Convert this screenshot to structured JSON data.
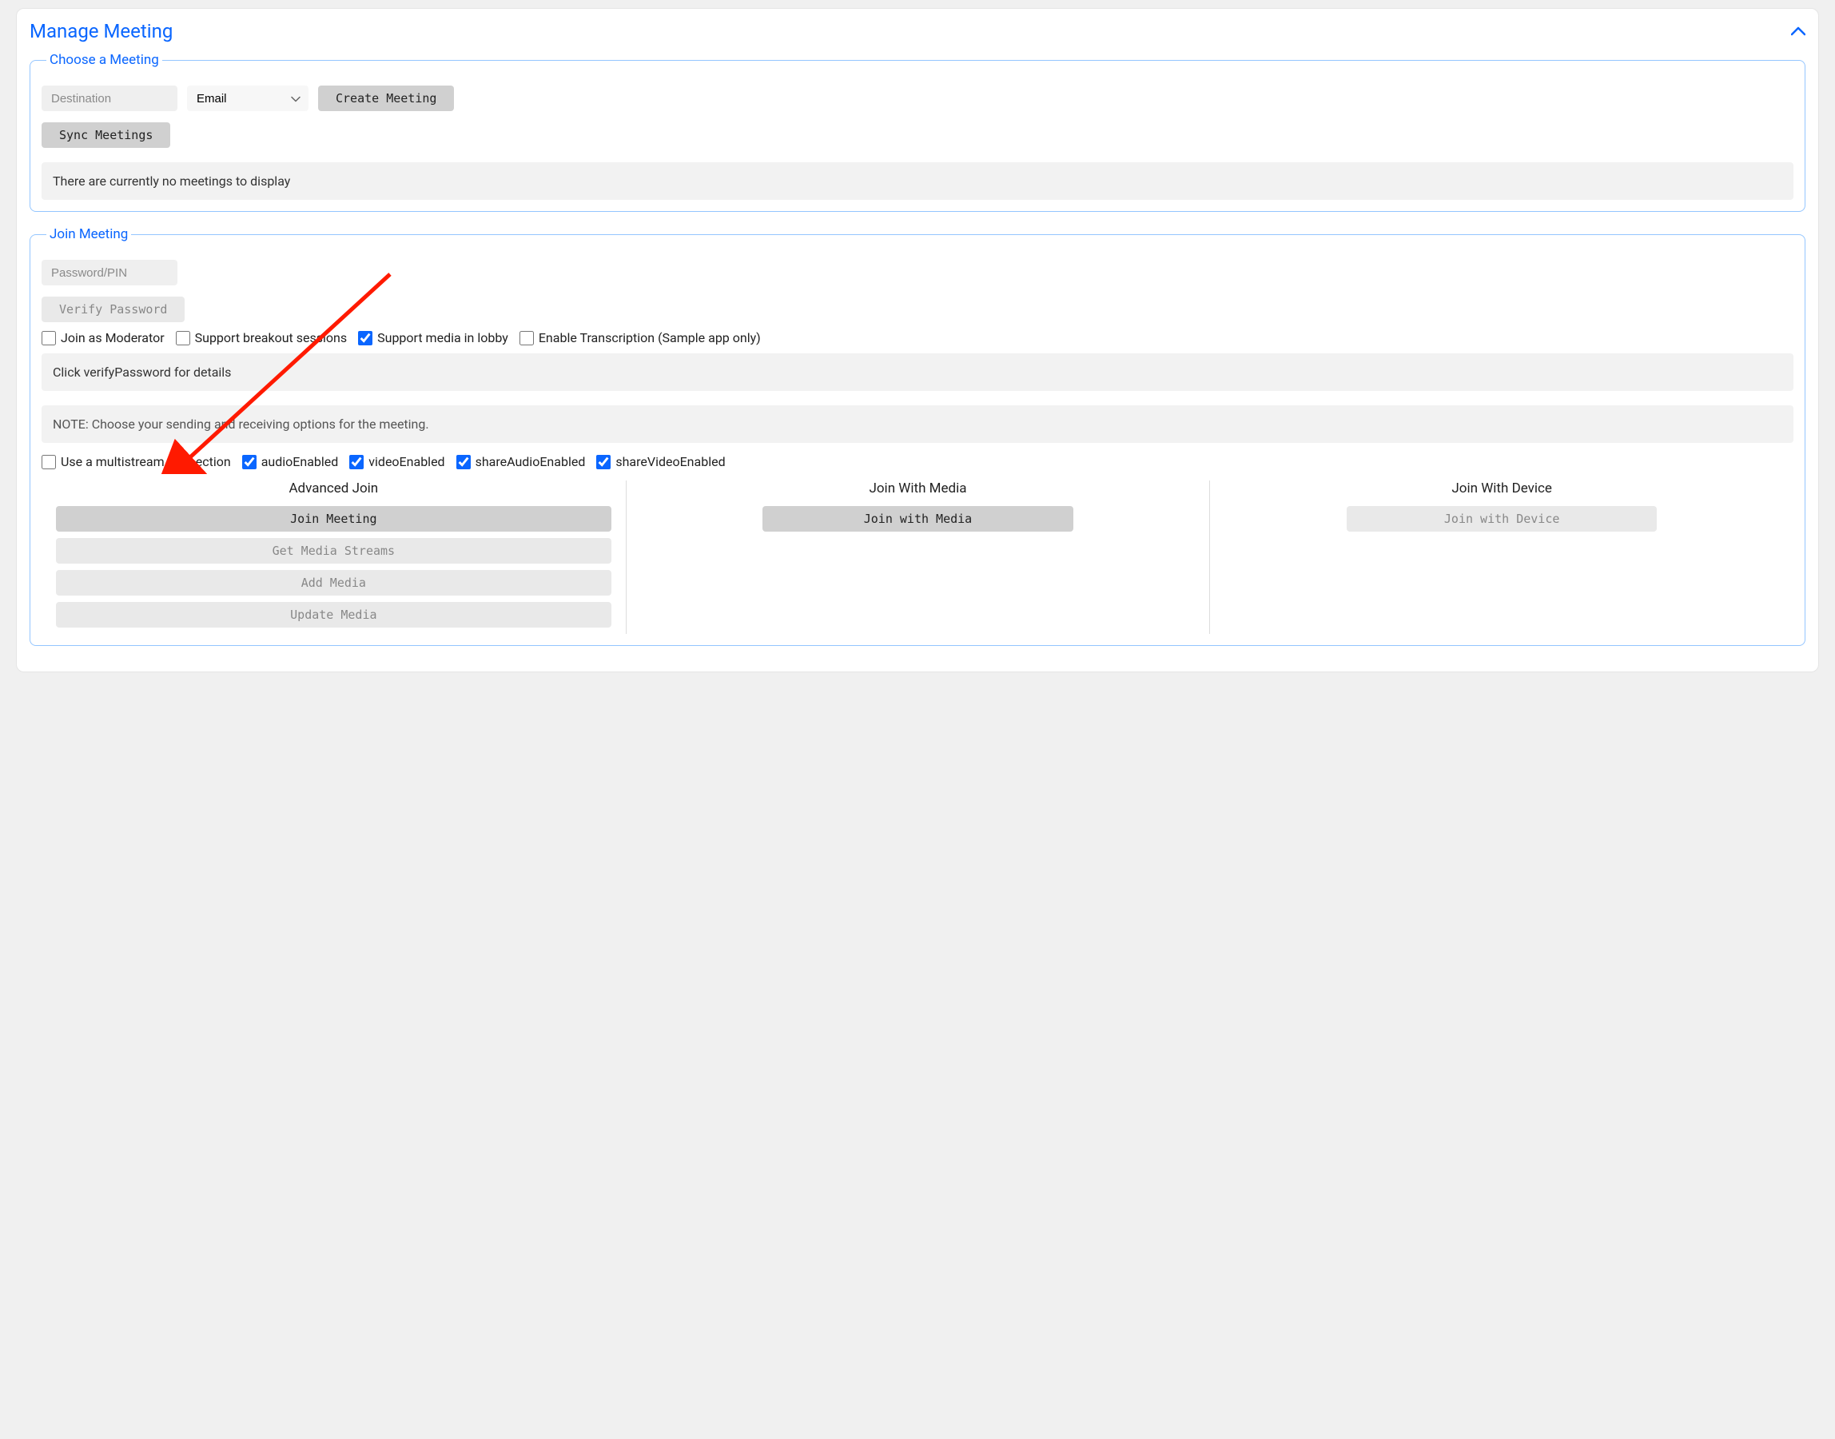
{
  "panel": {
    "title": "Manage Meeting"
  },
  "choose": {
    "legend": "Choose a Meeting",
    "destination_placeholder": "Destination",
    "email_option": "Email",
    "create_btn": "Create Meeting",
    "sync_btn": "Sync Meetings",
    "empty_msg": "There are currently no meetings to display"
  },
  "join": {
    "legend": "Join Meeting",
    "password_placeholder": "Password/PIN",
    "verify_btn": "Verify Password",
    "moderator_label": "Join as Moderator",
    "breakout_label": "Support breakout sessions",
    "lobby_label": "Support media in lobby",
    "transcription_label": "Enable Transcription (Sample app only)",
    "detail_msg": "Click verifyPassword for details",
    "note_msg": "NOTE: Choose your sending and receiving options for the meeting.",
    "multistream_label": "Use a multistream connection",
    "audio_label": "audioEnabled",
    "video_label": "videoEnabled",
    "share_audio_label": "shareAudioEnabled",
    "share_video_label": "shareVideoEnabled",
    "columns": {
      "advanced": {
        "heading": "Advanced Join",
        "join": "Join Meeting",
        "get_streams": "Get Media Streams",
        "add_media": "Add Media",
        "update_media": "Update Media"
      },
      "with_media": {
        "heading": "Join With Media",
        "btn": "Join with Media"
      },
      "with_device": {
        "heading": "Join With Device",
        "btn": "Join with Device"
      }
    },
    "checkbox_state": {
      "moderator": false,
      "breakout": false,
      "lobby": true,
      "transcription": false,
      "multistream": false,
      "audio": true,
      "video": true,
      "share_audio": true,
      "share_video": true
    }
  }
}
